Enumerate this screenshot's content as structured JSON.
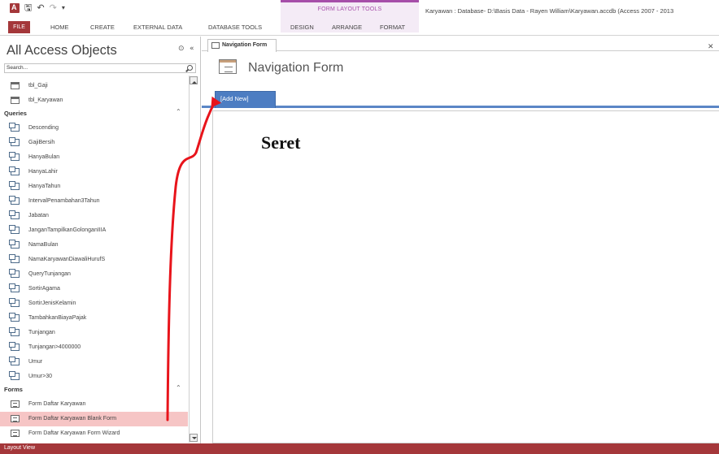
{
  "window": {
    "title": "Karyawan : Database- D:\\Basis Data - Rayen William\\Karyawan.accdb (Access 2007 - 2013"
  },
  "contextual_group": "FORM LAYOUT TOOLS",
  "ribbon": {
    "file": "FILE",
    "tabs": [
      "HOME",
      "CREATE",
      "EXTERNAL DATA",
      "DATABASE TOOLS",
      "DESIGN",
      "ARRANGE",
      "FORMAT"
    ]
  },
  "nav_pane": {
    "title": "All Access Objects",
    "search_placeholder": "Search...",
    "tables": [
      "tbl_Gaji",
      "tbl_Karyawan"
    ],
    "queries_label": "Queries",
    "queries": [
      "Descending",
      "GajiBersih",
      "HanyaBulan",
      "HanyaLahir",
      "HanyaTahun",
      "IntervalPenambahan3Tahun",
      "Jabatan",
      "JanganTampilkanGolonganIIIA",
      "NamaBulan",
      "NamaKaryawanDiawaliHurufS",
      "QueryTunjangan",
      "SortirAgama",
      "SortirJenisKelamin",
      "TambahkanBiayaPajak",
      "Tunjangan",
      "Tunjangan>4000000",
      "Umur",
      "Umur>30"
    ],
    "forms_label": "Forms",
    "forms": [
      "Form Daftar Karyawan",
      "Form Daftar Karyawan Blank Form",
      "Form Daftar Karyawan Form Wizard"
    ]
  },
  "document": {
    "tab_label": "Navigation Form",
    "form_title": "Navigation Form",
    "add_new_label": "[Add New]"
  },
  "annotation": "Seret",
  "status": "Layout View",
  "colors": {
    "accent": "#a4373a",
    "contextual": "#a64ea9",
    "nav_button": "#4d7dc2",
    "selected_row": "#f6c5c5",
    "arrow": "#e8141b"
  }
}
